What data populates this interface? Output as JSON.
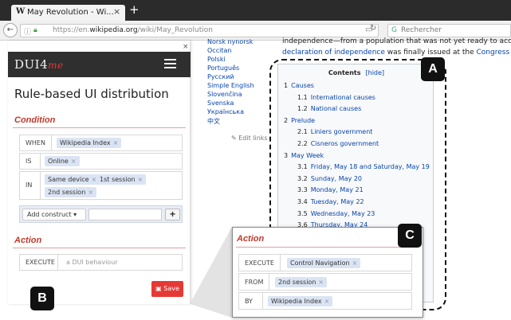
{
  "browser": {
    "tab_icon": "W",
    "tab_title": "May Revolution - Wi...",
    "tab_close": "×",
    "new_tab": "+",
    "url_prefix": "https://en.",
    "url_domain": "wikipedia.org",
    "url_path": "/wiki/May_Revolution",
    "search_placeholder": "Rechercher"
  },
  "wiki": {
    "languages": [
      "Norsk nynorsk",
      "Occitan",
      "Polski",
      "Português",
      "Русский",
      "Simple English",
      "Slovenčina",
      "Svenska",
      "Українська",
      "中文"
    ],
    "edit_links": "Edit links",
    "body_line1": "independence—from a population that was not yet ready to acc",
    "body_line2_link": "declaration of independence",
    "body_line2_text": " was finally issued at the ",
    "body_line2_link2": "Congress",
    "toc": {
      "title": "Contents",
      "hide": "[hide]",
      "items": [
        {
          "num": "1",
          "label": "Causes",
          "level": 1
        },
        {
          "num": "1.1",
          "label": "International causes",
          "level": 2
        },
        {
          "num": "1.2",
          "label": "National causes",
          "level": 2
        },
        {
          "num": "2",
          "label": "Prelude",
          "level": 1
        },
        {
          "num": "2.1",
          "label": "Liniers government",
          "level": 2
        },
        {
          "num": "2.2",
          "label": "Cisneros government",
          "level": 2
        },
        {
          "num": "3",
          "label": "May Week",
          "level": 1
        },
        {
          "num": "3.1",
          "label": "Friday, May 18 and Saturday, May 19",
          "level": 2
        },
        {
          "num": "3.2",
          "label": "Sunday, May 20",
          "level": 2
        },
        {
          "num": "3.3",
          "label": "Monday, May 21",
          "level": 2
        },
        {
          "num": "3.4",
          "label": "Tuesday, May 22",
          "level": 2
        },
        {
          "num": "3.5",
          "label": "Wednesday, May 23",
          "level": 2
        },
        {
          "num": "3.6",
          "label": "Thursday, May 24",
          "level": 2
        }
      ]
    }
  },
  "panel": {
    "close": "×",
    "logo_main": "DUI4",
    "logo_accent": "me",
    "title": "Rule-based UI distribution",
    "condition_title": "Condition",
    "when_label": "WHEN",
    "when_tag": "Wikipedia Index",
    "is_label": "IS",
    "is_tag": "Online",
    "in_label": "IN",
    "in_tags": [
      "Same device",
      "1st session",
      "2nd session"
    ],
    "add_construct": "Add construct ▾",
    "plus": "+",
    "action_title": "Action",
    "execute_label": "EXECUTE",
    "execute_placeholder": "a DUI behaviour",
    "save_label": "Save"
  },
  "zoom": {
    "action_title": "Action",
    "execute_label": "EXECUTE",
    "execute_tag": "Control Navigation",
    "from_label": "FROM",
    "from_tag": "2nd session",
    "by_label": "BY",
    "by_tag": "Wikipedia Index"
  },
  "badges": {
    "a": "A",
    "b": "B",
    "c": "C"
  },
  "colors": {
    "accent_red": "#e53935",
    "tag_blue": "#dbe4f3",
    "link_blue": "#0645ad",
    "header_dark": "#2f2f2f"
  }
}
